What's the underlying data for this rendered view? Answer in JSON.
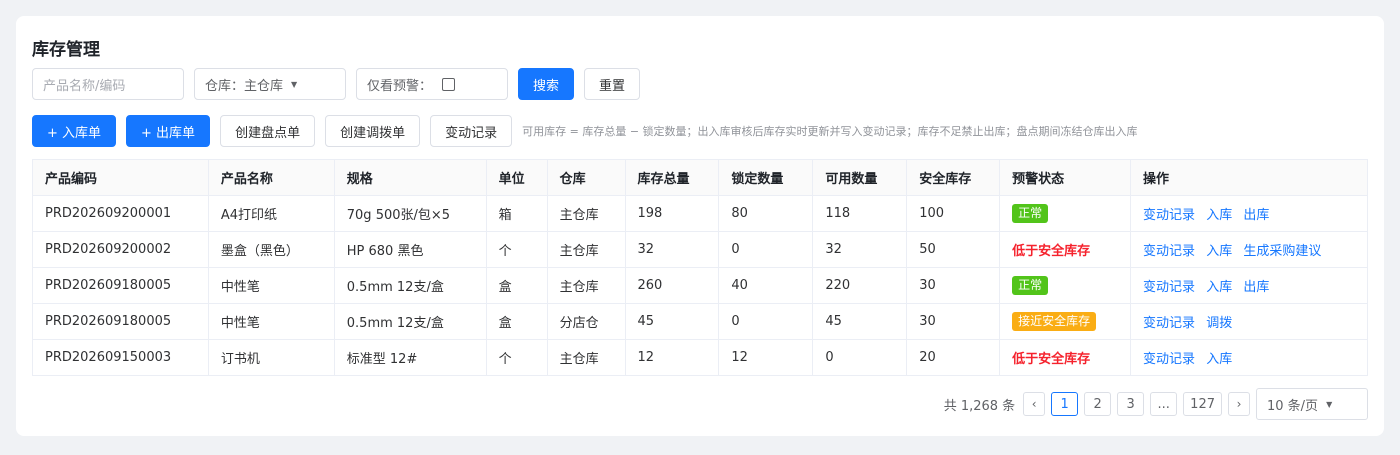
{
  "page": {
    "title": "库存管理"
  },
  "filters": {
    "search_placeholder": "产品名称/编码",
    "warehouse_label": "仓库：主仓库",
    "warn_only_label": "仅看预警：",
    "search_button": "搜索",
    "reset_button": "重置"
  },
  "toolbar": {
    "inbound": "+ 入库单",
    "outbound": "+ 出库单",
    "stocktake": "创建盘点单",
    "transfer": "创建调拨单",
    "records": "变动记录",
    "hint": "可用库存 = 库存总量 − 锁定数量；出入库审核后库存实时更新并写入变动记录；库存不足禁止出库；盘点期间冻结仓库出入库"
  },
  "table": {
    "headers": [
      "产品编码",
      "产品名称",
      "规格",
      "单位",
      "仓库",
      "库存总量",
      "锁定数量",
      "可用数量",
      "安全库存",
      "预警状态",
      "操作"
    ],
    "rows": [
      {
        "code": "PRD202609200001",
        "name": "A4打印纸",
        "spec": "70g 500张/包×5",
        "unit": "箱",
        "warehouse": "主仓库",
        "total": "198",
        "locked": "80",
        "available": "118",
        "safety": "100",
        "status": "正常",
        "ops": [
          "变动记录",
          "入库",
          "出库"
        ]
      },
      {
        "code": "PRD202609200002",
        "name": "墨盒（黑色）",
        "spec": "HP 680 黑色",
        "unit": "个",
        "warehouse": "主仓库",
        "total": "32",
        "locked": "0",
        "available": "32",
        "safety": "50",
        "status": "低于安全库存",
        "ops": [
          "变动记录",
          "入库",
          "生成采购建议"
        ]
      },
      {
        "code": "PRD202609180005",
        "name": "中性笔",
        "spec": "0.5mm 12支/盒",
        "unit": "盒",
        "warehouse": "主仓库",
        "total": "260",
        "locked": "40",
        "available": "220",
        "safety": "30",
        "status": "正常",
        "ops": [
          "变动记录",
          "入库",
          "出库"
        ]
      },
      {
        "code": "PRD202609180005",
        "name": "中性笔",
        "spec": "0.5mm 12支/盒",
        "unit": "盒",
        "warehouse": "分店仓",
        "total": "45",
        "locked": "0",
        "available": "45",
        "safety": "30",
        "status": "接近安全库存",
        "ops": [
          "变动记录",
          "调拨"
        ]
      },
      {
        "code": "PRD202609150003",
        "name": "订书机",
        "spec": "标准型 12#",
        "unit": "个",
        "warehouse": "主仓库",
        "total": "12",
        "locked": "12",
        "available": "0",
        "safety": "20",
        "status": "低于安全库存",
        "ops": [
          "变动记录",
          "入库"
        ]
      }
    ]
  },
  "pagination": {
    "total_text": "共 1,268 条",
    "prev": "‹",
    "pages": [
      "1",
      "2",
      "3",
      "...",
      "127"
    ],
    "current": "1",
    "next": "›",
    "page_size": "10 条/页"
  },
  "colors": {
    "primary": "#1677ff",
    "success": "#52c41a",
    "warning": "#faad14",
    "danger": "#f5222d"
  }
}
